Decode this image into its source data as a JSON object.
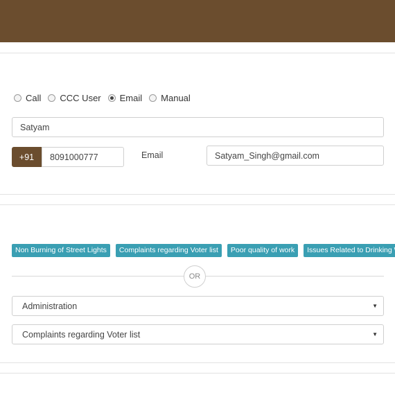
{
  "contact_mode": {
    "options": [
      {
        "label": "Call",
        "selected": false
      },
      {
        "label": "CCC User",
        "selected": false
      },
      {
        "label": "Email",
        "selected": true
      },
      {
        "label": "Manual",
        "selected": false
      }
    ]
  },
  "form": {
    "name_value": "Satyam",
    "country_code": "+91",
    "phone_value": "8091000777",
    "email_label": "Email",
    "email_value": "Satyam_Singh@gmail.com"
  },
  "quick_tags": [
    "Non Burning of Street Lights",
    "Complaints regarding Voter list",
    "Poor quality of work",
    "Issues Related to Drinking Water"
  ],
  "separator": {
    "or_label": "OR"
  },
  "selects": {
    "department_value": "Administration",
    "category_value": "Complaints regarding Voter list"
  },
  "colors": {
    "header_brown": "#6b4d2e",
    "tag_teal": "#3a9fb3"
  },
  "icons": {
    "select_caret": "caret-down-icon"
  }
}
